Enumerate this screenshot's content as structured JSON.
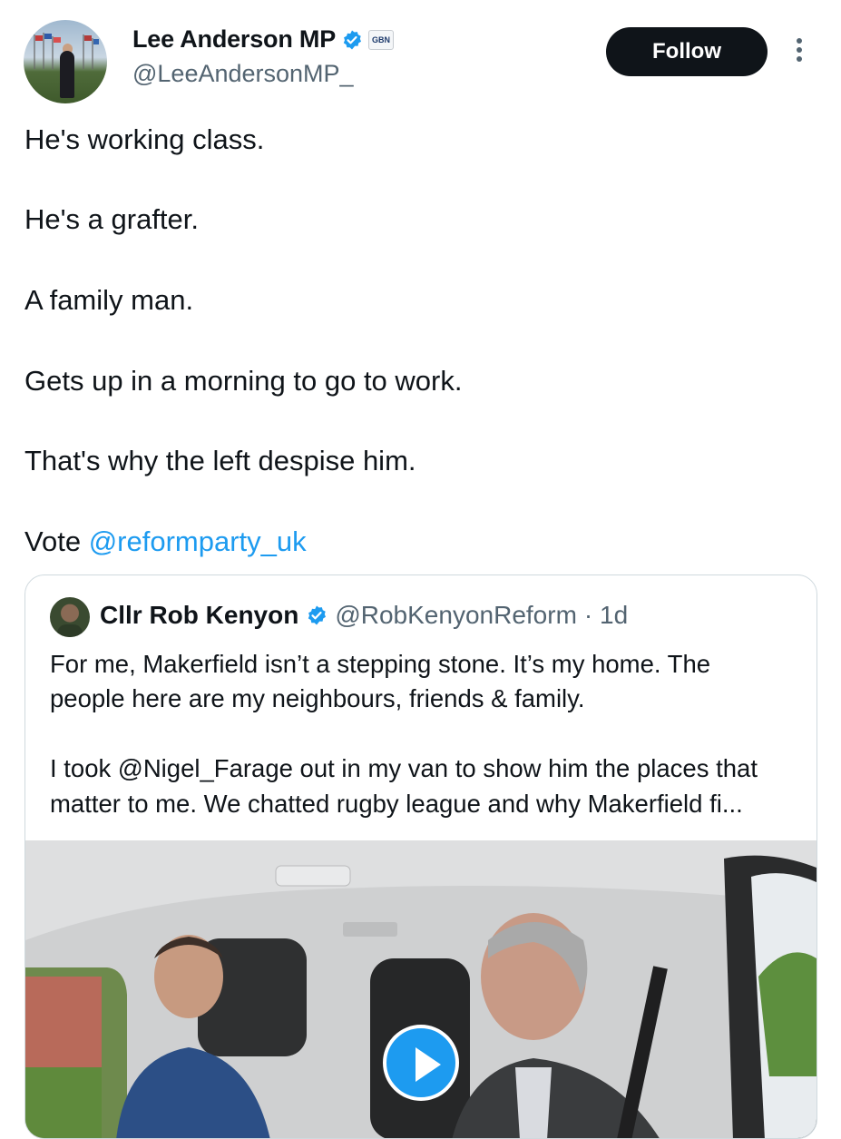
{
  "author": {
    "display_name": "Lee Anderson MP",
    "handle": "@LeeAndersonMP_",
    "affiliation_badge": "GBN",
    "verified_icon": "verified-badge-icon"
  },
  "actions": {
    "follow_label": "Follow",
    "more_icon": "more-options-icon"
  },
  "tweet": {
    "lines": [
      "He's working class.",
      "He's a grafter.",
      "A family man.",
      "Gets up in a morning to go to work.",
      "That's why the left despise him."
    ],
    "vote_prefix": "Vote",
    "vote_mention": "@reformparty_uk"
  },
  "quote": {
    "display_name": "Cllr Rob Kenyon",
    "handle": "@RobKenyonReform",
    "time": "· 1d",
    "text_lines": [
      "For me, Makerfield isn’t a stepping stone. It’s my home. The",
      "people here are my neighbours, friends & family.",
      "I took @Nigel_Farage out in my van to show him the places that",
      "matter to me. We chatted rugby league and why Makerfield fi..."
    ],
    "media_icon": "play-icon"
  },
  "colors": {
    "accent": "#1d9bf0",
    "text": "#0f1419",
    "secondary": "#536471",
    "border": "#cfd9de",
    "follow_bg": "#0f1419"
  }
}
